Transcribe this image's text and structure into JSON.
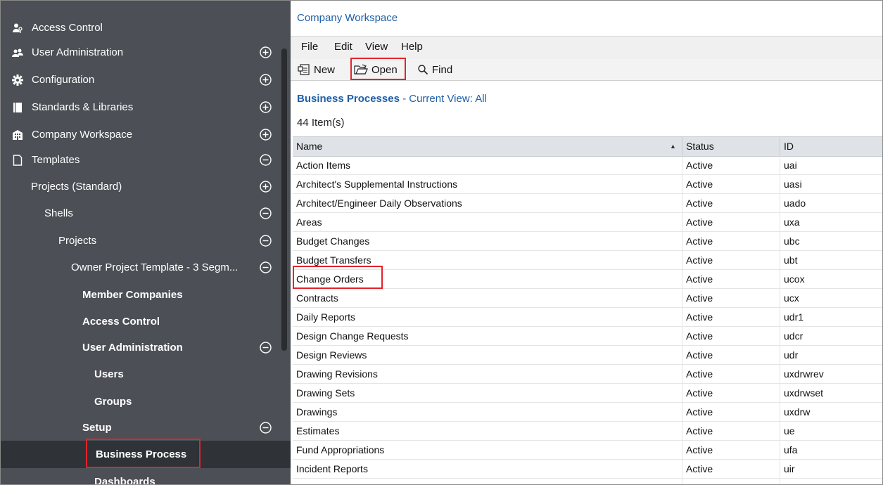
{
  "sidebar": {
    "items": [
      {
        "label": "Access Control",
        "icon": "key-people-icon",
        "toggle": ""
      },
      {
        "label": "User Administration",
        "icon": "users-icon",
        "toggle": "expand"
      },
      {
        "label": "Configuration",
        "icon": "gear-icon",
        "toggle": "expand"
      },
      {
        "label": "Standards & Libraries",
        "icon": "book-icon",
        "toggle": "expand"
      },
      {
        "label": "Company Workspace",
        "icon": "building-icon",
        "toggle": "expand"
      },
      {
        "label": "Templates",
        "icon": "document-icon",
        "toggle": "collapse"
      },
      {
        "label": "Projects (Standard)",
        "toggle": "expand"
      },
      {
        "label": "Shells",
        "toggle": "collapse"
      },
      {
        "label": "Projects",
        "toggle": "collapse"
      },
      {
        "label": "Owner Project Template - 3 Segm...",
        "toggle": "collapse"
      },
      {
        "label": "Member Companies",
        "toggle": ""
      },
      {
        "label": "Access Control",
        "toggle": ""
      },
      {
        "label": "User Administration",
        "toggle": "collapse"
      },
      {
        "label": "Users",
        "toggle": ""
      },
      {
        "label": "Groups",
        "toggle": ""
      },
      {
        "label": "Setup",
        "toggle": "collapse"
      },
      {
        "label": "Business Process",
        "toggle": "",
        "selected": true
      },
      {
        "label": "Dashboards",
        "toggle": ""
      }
    ]
  },
  "main": {
    "workspace_title": "Company Workspace",
    "menu": [
      "File",
      "Edit",
      "View",
      "Help"
    ],
    "toolbar": {
      "new_label": "New",
      "open_label": "Open",
      "find_label": "Find"
    },
    "header": {
      "title": "Business Processes",
      "view_label": "- Current View:",
      "view_value": "All"
    },
    "item_count": "44  Item(s)",
    "columns": {
      "name": "Name",
      "status": "Status",
      "id": "ID"
    },
    "rows": [
      {
        "name": "Action Items",
        "status": "Active",
        "id": "uai"
      },
      {
        "name": "Architect's Supplemental Instructions",
        "status": "Active",
        "id": "uasi"
      },
      {
        "name": "Architect/Engineer Daily Observations",
        "status": "Active",
        "id": "uado"
      },
      {
        "name": "Areas",
        "status": "Active",
        "id": "uxa"
      },
      {
        "name": "Budget Changes",
        "status": "Active",
        "id": "ubc"
      },
      {
        "name": "Budget Transfers",
        "status": "Active",
        "id": "ubt"
      },
      {
        "name": "Change Orders",
        "status": "Active",
        "id": "ucox"
      },
      {
        "name": "Contracts",
        "status": "Active",
        "id": "ucx"
      },
      {
        "name": "Daily Reports",
        "status": "Active",
        "id": "udr1"
      },
      {
        "name": "Design Change Requests",
        "status": "Active",
        "id": "udcr"
      },
      {
        "name": "Design Reviews",
        "status": "Active",
        "id": "udr"
      },
      {
        "name": "Drawing Revisions",
        "status": "Active",
        "id": "uxdrwrev"
      },
      {
        "name": "Drawing Sets",
        "status": "Active",
        "id": "uxdrwset"
      },
      {
        "name": "Drawings",
        "status": "Active",
        "id": "uxdrw"
      },
      {
        "name": "Estimates",
        "status": "Active",
        "id": "ue"
      },
      {
        "name": "Fund Appropriations",
        "status": "Active",
        "id": "ufa"
      },
      {
        "name": "Incident Reports",
        "status": "Active",
        "id": "uir"
      },
      {
        "name": "",
        "status": "",
        "id": ""
      }
    ]
  },
  "colors": {
    "sidebar_bg": "#4c4f55",
    "selected_bg": "#2f3237",
    "highlight": "#e2242b",
    "link": "#1f5fa8"
  }
}
